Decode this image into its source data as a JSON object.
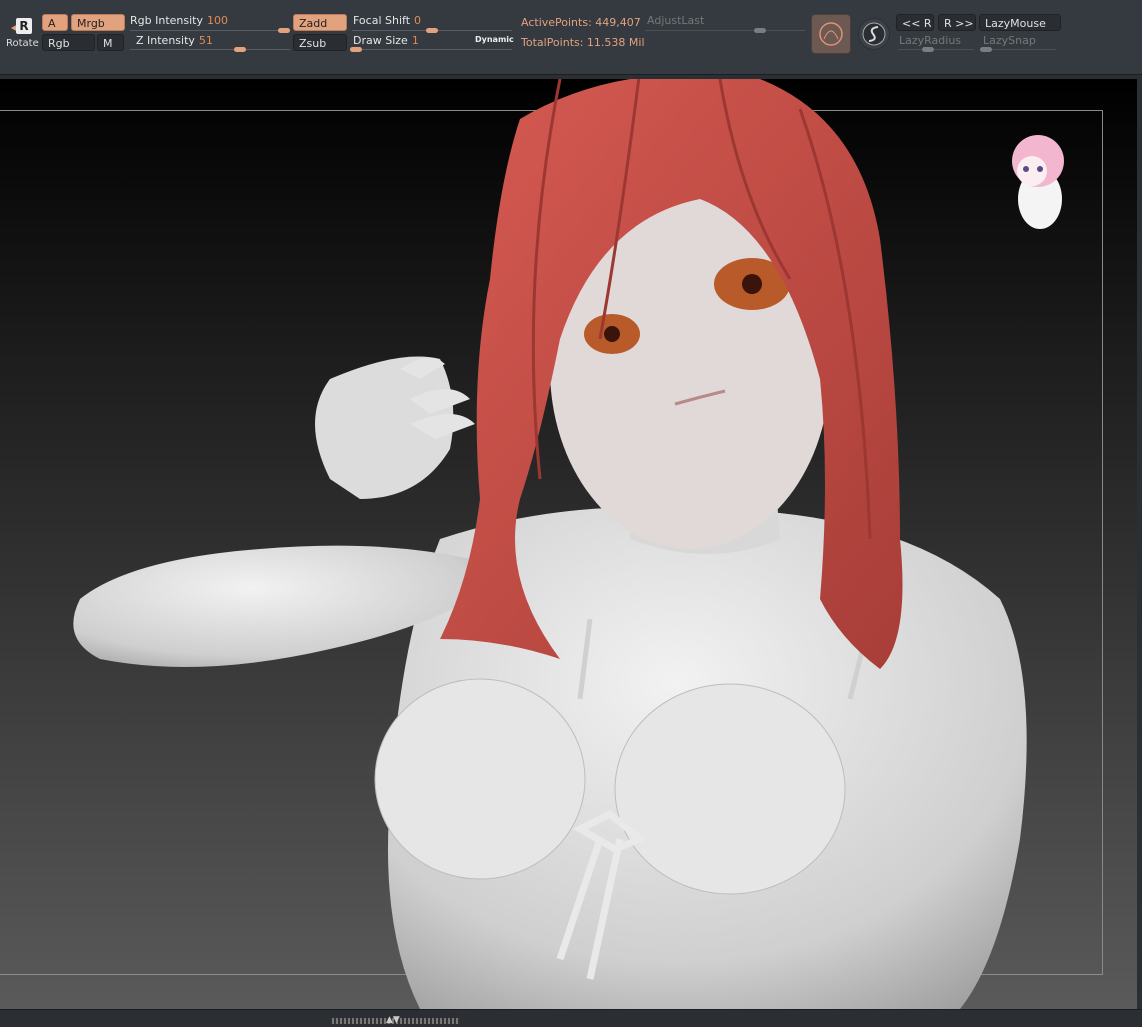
{
  "toolbar": {
    "rotate": {
      "label": "Rotate",
      "glyph": "R"
    },
    "a_btn": "A",
    "mrgb_btn": "Mrgb",
    "rgb_btn": "Rgb",
    "m_btn": "M",
    "rgb_intensity": {
      "label": "Rgb Intensity",
      "value": "100"
    },
    "z_intensity": {
      "label": "Z Intensity",
      "value": "51"
    },
    "zadd_btn": "Zadd",
    "zsub_btn": "Zsub",
    "focal_shift": {
      "label": "Focal Shift",
      "value": "0"
    },
    "draw_size": {
      "label": "Draw Size",
      "value": "1",
      "badge": "Dynamic"
    },
    "active_points": "ActivePoints: 449,407",
    "total_points": "TotalPoints: 11.538 Mil",
    "adjust_last": "AdjustLast",
    "prev_btn": "<< R",
    "next_btn": "R >>",
    "lazy_mouse": "LazyMouse",
    "lazy_radius": "LazyRadius",
    "lazy_snap": "LazySnap"
  },
  "colors": {
    "accent": "#e3a27e",
    "value_text": "#e08a55",
    "toolbar_bg": "#343a40",
    "hair": "#c8514a",
    "skin": "#d9d9d9"
  },
  "icons": {
    "rotate": "rotate-icon",
    "material": "material-sphere-icon",
    "stroke": "stroke-type-icon"
  }
}
